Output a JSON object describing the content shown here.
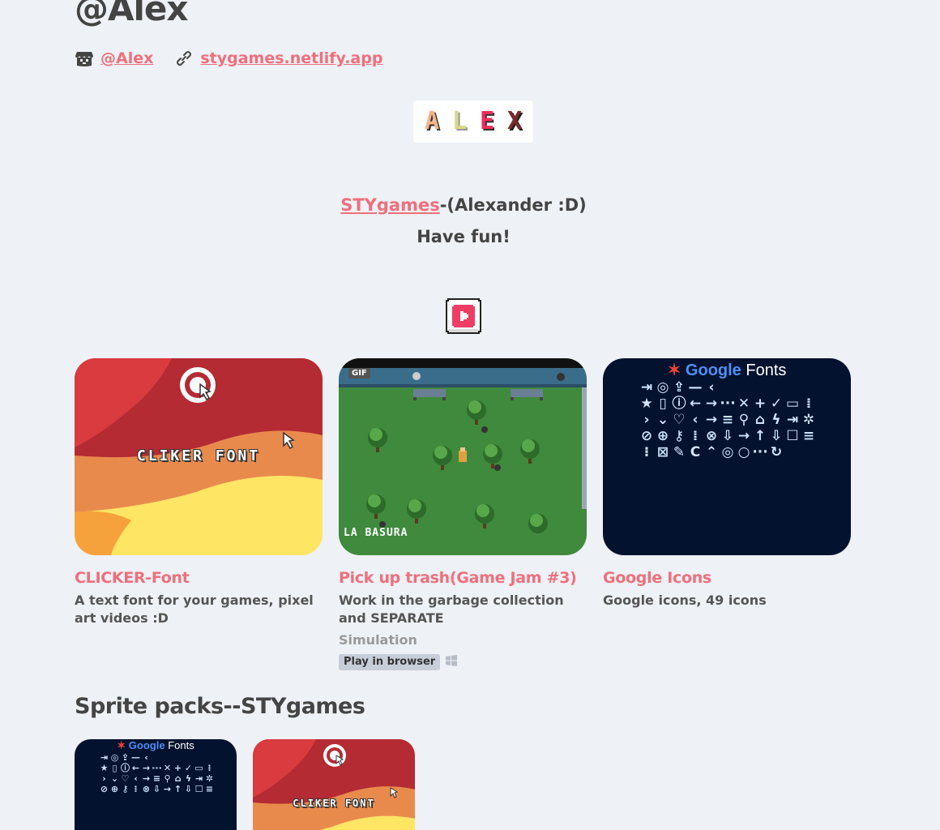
{
  "profile": {
    "title": "@Alex",
    "itch_link": "@Alex",
    "site_link": "stygames.netlify.app"
  },
  "banner": {
    "letters": [
      "A",
      "L",
      "E",
      "X"
    ]
  },
  "about": {
    "brand_link": "STYgames",
    "brand_suffix": "-(Alexander :D)",
    "tagline": "Have fun!"
  },
  "games": [
    {
      "title": "CLICKER-Font",
      "thumb_text": "CLIKER FONT",
      "description": "A text font for your games, pixel art videos :D"
    },
    {
      "title": "Pick up trash(Game Jam #3)",
      "thumb_badge": "GIF",
      "thumb_caption": "LA BASURA",
      "description": "Work in the garbage collection and SEPARATE",
      "genre": "Simulation",
      "platform_badge": "Play in browser"
    },
    {
      "title": "Google Icons",
      "thumb_head_google": "Google",
      "thumb_head_fonts": "Fonts",
      "description": "Google icons, 49 icons"
    }
  ],
  "sprite_section": {
    "title": "Sprite packs--STYgames",
    "cards": [
      {
        "thumb_head_google": "Google",
        "thumb_head_fonts": "Fonts"
      },
      {
        "thumb_text": "CLIKER FONT"
      }
    ]
  },
  "icons": {
    "itch": "itch-io-icon",
    "link": "link-icon",
    "youtube": "youtube-icon",
    "windows": "windows-icon"
  },
  "colors": {
    "accent": "#ef6f7d",
    "text": "#444444",
    "background": "#eef1f5"
  }
}
